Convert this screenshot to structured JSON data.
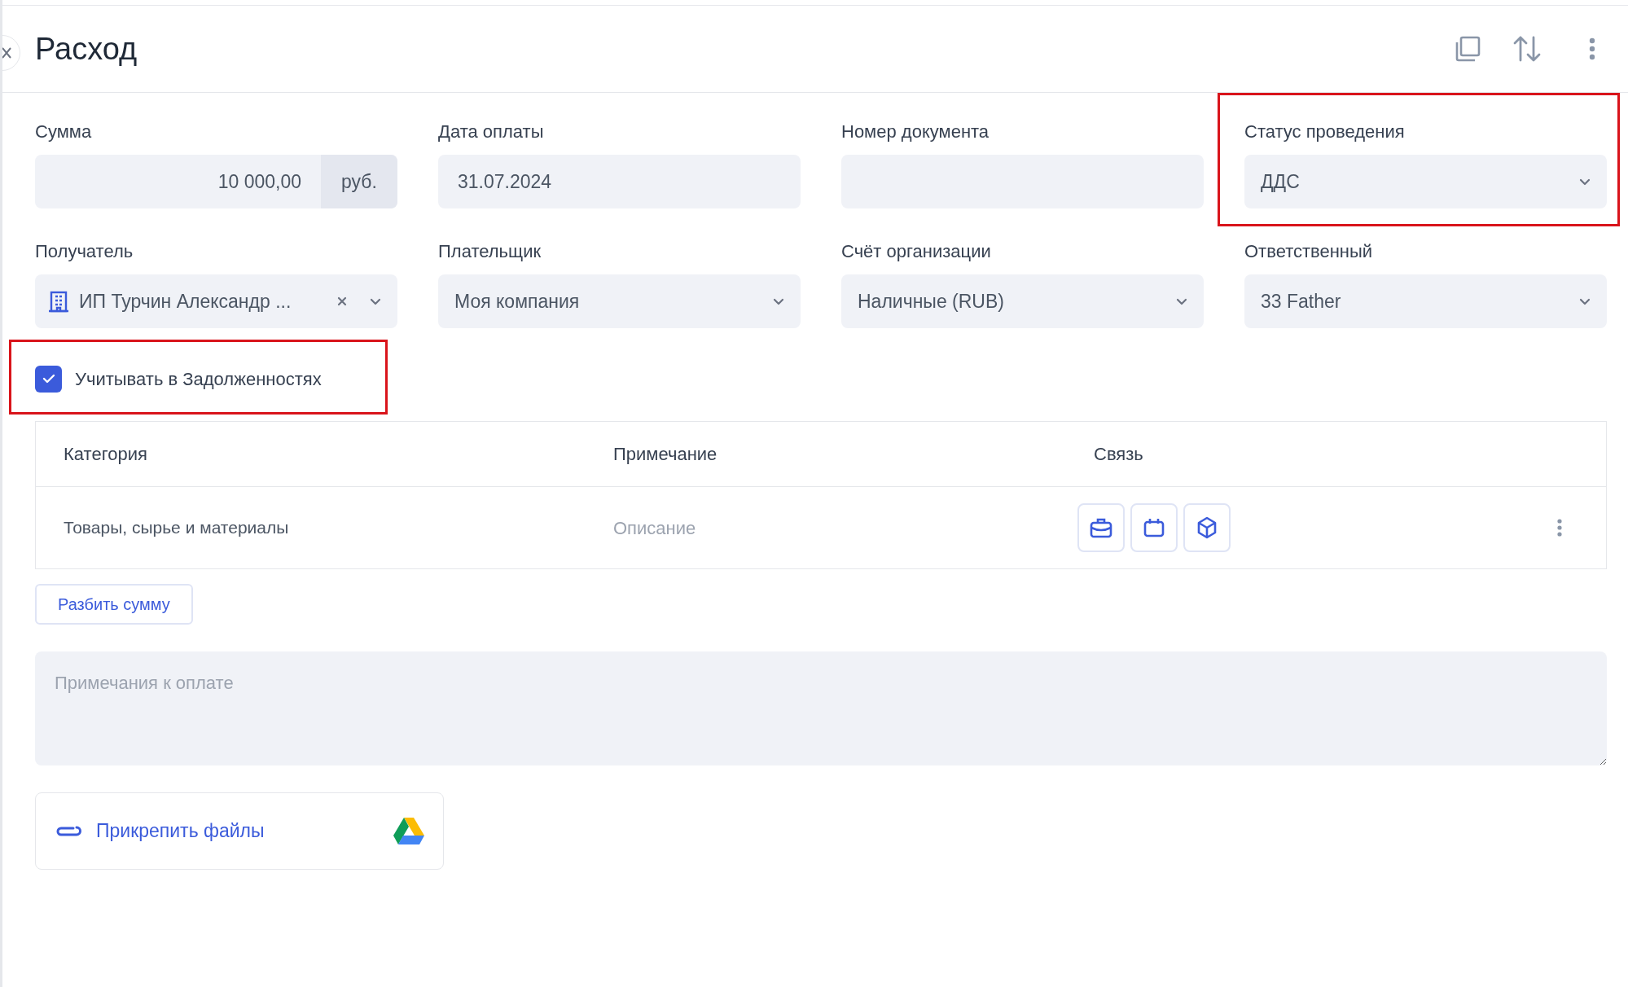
{
  "header": {
    "title": "Расход"
  },
  "fields": [
    {
      "label": "Сумма",
      "kind": "amount",
      "value": "10 000,00",
      "unit": "руб."
    },
    {
      "label": "Дата оплаты",
      "kind": "text",
      "value": "31.07.2024"
    },
    {
      "label": "Номер документа",
      "kind": "text"
    },
    {
      "label": "Статус проведения",
      "kind": "select",
      "value": "ДДС",
      "highlighted": true
    },
    {
      "label": "Получатель",
      "kind": "entity",
      "value": "ИП Турчин Александр ..."
    },
    {
      "label": "Плательщик",
      "kind": "select",
      "value": "Моя компания"
    },
    {
      "label": "Счёт организации",
      "kind": "select",
      "value": "Наличные (RUB)"
    },
    {
      "label": "Ответственный",
      "kind": "select",
      "value": "33 Father"
    }
  ],
  "debt_checkbox": {
    "label": "Учитывать в Задолженностях",
    "checked": true,
    "highlighted": true
  },
  "table": {
    "columns": [
      "Категория",
      "Примечание",
      "Связь"
    ],
    "rows": [
      {
        "category": "Товары, сырье и материалы",
        "note_placeholder": "Описание"
      }
    ]
  },
  "split_button": "Разбить сумму",
  "notes": {
    "placeholder": "Примечания к оплате"
  },
  "attach": {
    "label": "Прикрепить файлы"
  }
}
